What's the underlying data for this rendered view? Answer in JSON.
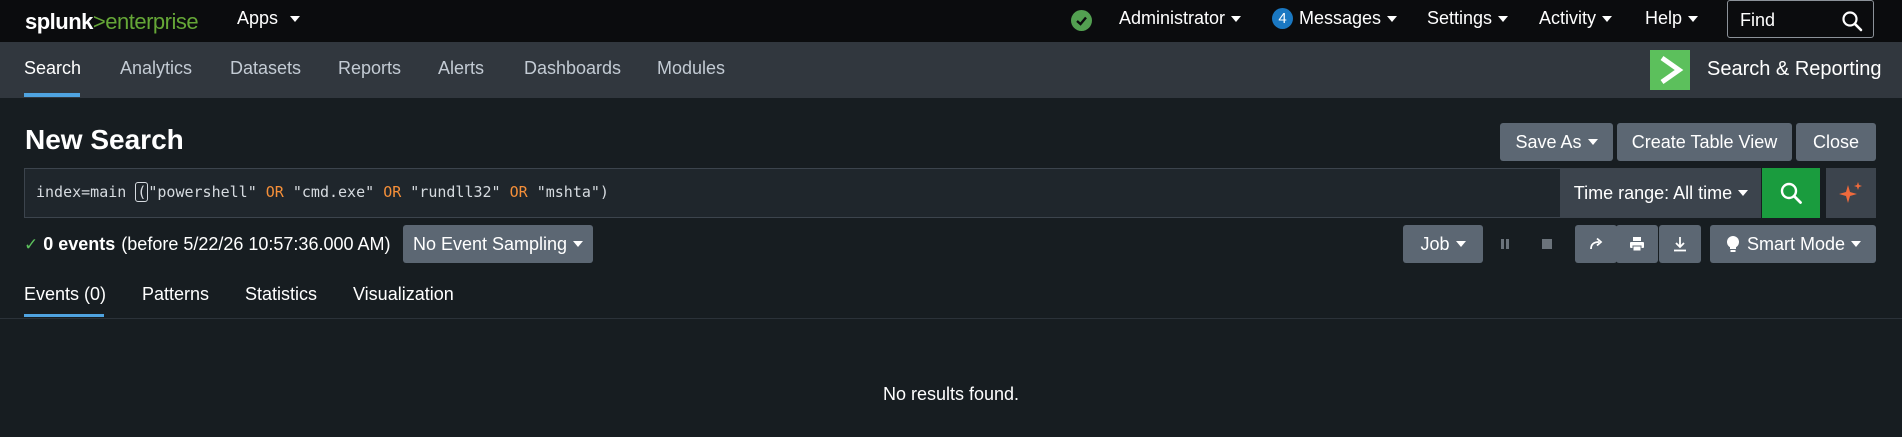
{
  "topbar": {
    "logo_a": "splunk",
    "logo_b": ">enterprise",
    "apps": "Apps",
    "user": "Administrator",
    "messages_count": "4",
    "messages": "Messages",
    "settings": "Settings",
    "activity": "Activity",
    "help": "Help",
    "find_placeholder": "Find"
  },
  "appbar": {
    "tabs": [
      "Search",
      "Analytics",
      "Datasets",
      "Reports",
      "Alerts",
      "Dashboards",
      "Modules"
    ],
    "active_tab": "Search",
    "app_name": "Search & Reporting",
    "app_logo_color": "#5cc05c"
  },
  "search": {
    "title": "New Search",
    "save_as": "Save As",
    "create_table_view": "Create Table View",
    "close": "Close",
    "query": {
      "p1": "index=main ",
      "p2": "(",
      "p3": "\"powershell\" ",
      "or1": "OR",
      "p4": " \"cmd.exe\" ",
      "or2": "OR",
      "p5": " \"rundll32\" ",
      "or3": "OR",
      "p6": " \"mshta\")"
    },
    "time_range": "Time range: All time",
    "submit_color": "#1a9c3e"
  },
  "status": {
    "events": "0 events",
    "before": "(before 5/22/26 10:57:36.000 AM)",
    "sampling": "No Event Sampling",
    "job": "Job",
    "mode": "Smart Mode"
  },
  "results_tabs": [
    "Events (0)",
    "Patterns",
    "Statistics",
    "Visualization"
  ],
  "results": {
    "empty_message": "No results found."
  }
}
